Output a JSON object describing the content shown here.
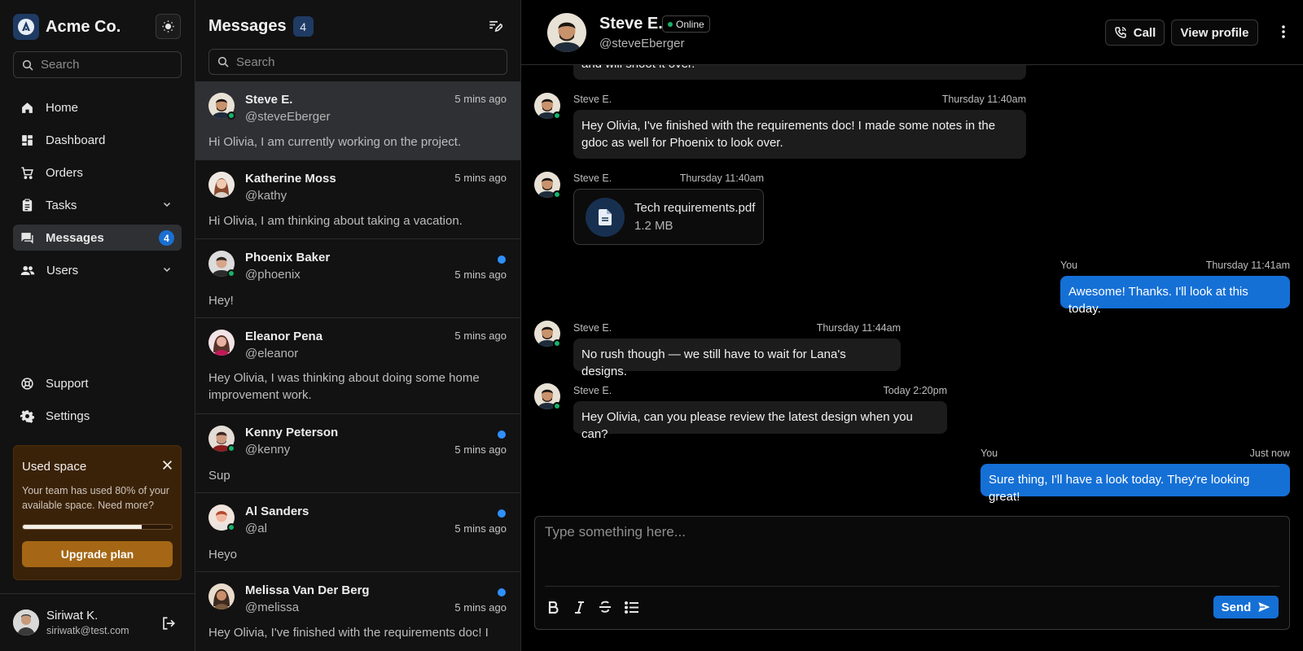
{
  "brand": {
    "name": "Acme Co."
  },
  "sidebar": {
    "search_placeholder": "Search",
    "nav": [
      {
        "label": "Home",
        "icon": "home-icon"
      },
      {
        "label": "Dashboard",
        "icon": "dashboard-icon"
      },
      {
        "label": "Orders",
        "icon": "cart-icon"
      },
      {
        "label": "Tasks",
        "icon": "tasks-icon"
      },
      {
        "label": "Messages",
        "icon": "messages-icon",
        "badge": "4",
        "active": true
      },
      {
        "label": "Users",
        "icon": "users-icon"
      }
    ],
    "footer_nav": [
      {
        "label": "Support",
        "icon": "support-icon"
      },
      {
        "label": "Settings",
        "icon": "gear-icon"
      }
    ],
    "used_space": {
      "title": "Used space",
      "text": "Your team has used 80% of your available space. Need more?",
      "progress": 0.8,
      "button": "Upgrade plan"
    },
    "user": {
      "name": "Siriwat K.",
      "email": "siriwatk@test.com"
    }
  },
  "conversations": {
    "title": "Messages",
    "count": "4",
    "search_placeholder": "Search",
    "items": [
      {
        "name": "Steve E.",
        "handle": "@steveEberger",
        "time": "5 mins ago",
        "preview": "Hi Olivia, I am currently working on the project.",
        "unread": false,
        "online": true
      },
      {
        "name": "Katherine Moss",
        "handle": "@kathy",
        "time": "5 mins ago",
        "preview": "Hi Olivia, I am thinking about taking a vacation.",
        "unread": false,
        "online": false
      },
      {
        "name": "Phoenix Baker",
        "handle": "@phoenix",
        "time": "5 mins ago",
        "preview": "Hey!",
        "unread": true,
        "online": true
      },
      {
        "name": "Eleanor Pena",
        "handle": "@eleanor",
        "time": "5 mins ago",
        "preview": "Hey Olivia, I was thinking about doing some home improvement work.",
        "unread": false,
        "online": false
      },
      {
        "name": "Kenny Peterson",
        "handle": "@kenny",
        "time": "5 mins ago",
        "preview": "Sup",
        "unread": true,
        "online": true
      },
      {
        "name": "Al Sanders",
        "handle": "@al",
        "time": "5 mins ago",
        "preview": "Heyo",
        "unread": true,
        "online": true
      },
      {
        "name": "Melissa Van Der Berg",
        "handle": "@melissa",
        "time": "5 mins ago",
        "preview": "Hey Olivia, I've finished with the requirements doc! I",
        "unread": true,
        "online": false
      }
    ]
  },
  "chat": {
    "name": "Steve E.",
    "status": "Online",
    "handle": "@steveEberger",
    "call_label": "Call",
    "profile_label": "View profile",
    "partial_message": "and will shoot it over.",
    "messages": [
      {
        "sender": "Steve E.",
        "time": "Thursday 11:40am",
        "text": "Hey Olivia, I've finished with the requirements doc! I made some notes in the gdoc as well for Phoenix to look over."
      },
      {
        "sender": "Steve E.",
        "time": "Thursday 11:40am",
        "file_name": "Tech requirements.pdf",
        "file_size": "1.2 MB"
      },
      {
        "sender": "You",
        "time": "Thursday 11:41am",
        "text": "Awesome! Thanks. I'll look at this today."
      },
      {
        "sender": "Steve E.",
        "time": "Thursday 11:44am",
        "text": "No rush though — we still have to wait for Lana's designs."
      },
      {
        "sender": "Steve E.",
        "time": "Today 2:20pm",
        "text": "Hey Olivia, can you please review the latest design when you can?"
      },
      {
        "sender": "You",
        "time": "Just now",
        "text": "Sure thing, I'll have a look today. They're looking great!"
      }
    ],
    "composer_placeholder": "Type something here...",
    "send_label": "Send"
  },
  "colors": {
    "accent": "#1570d6",
    "online": "#17b26a",
    "warning_bg": "#3a2209",
    "upgrade": "#a56715"
  }
}
